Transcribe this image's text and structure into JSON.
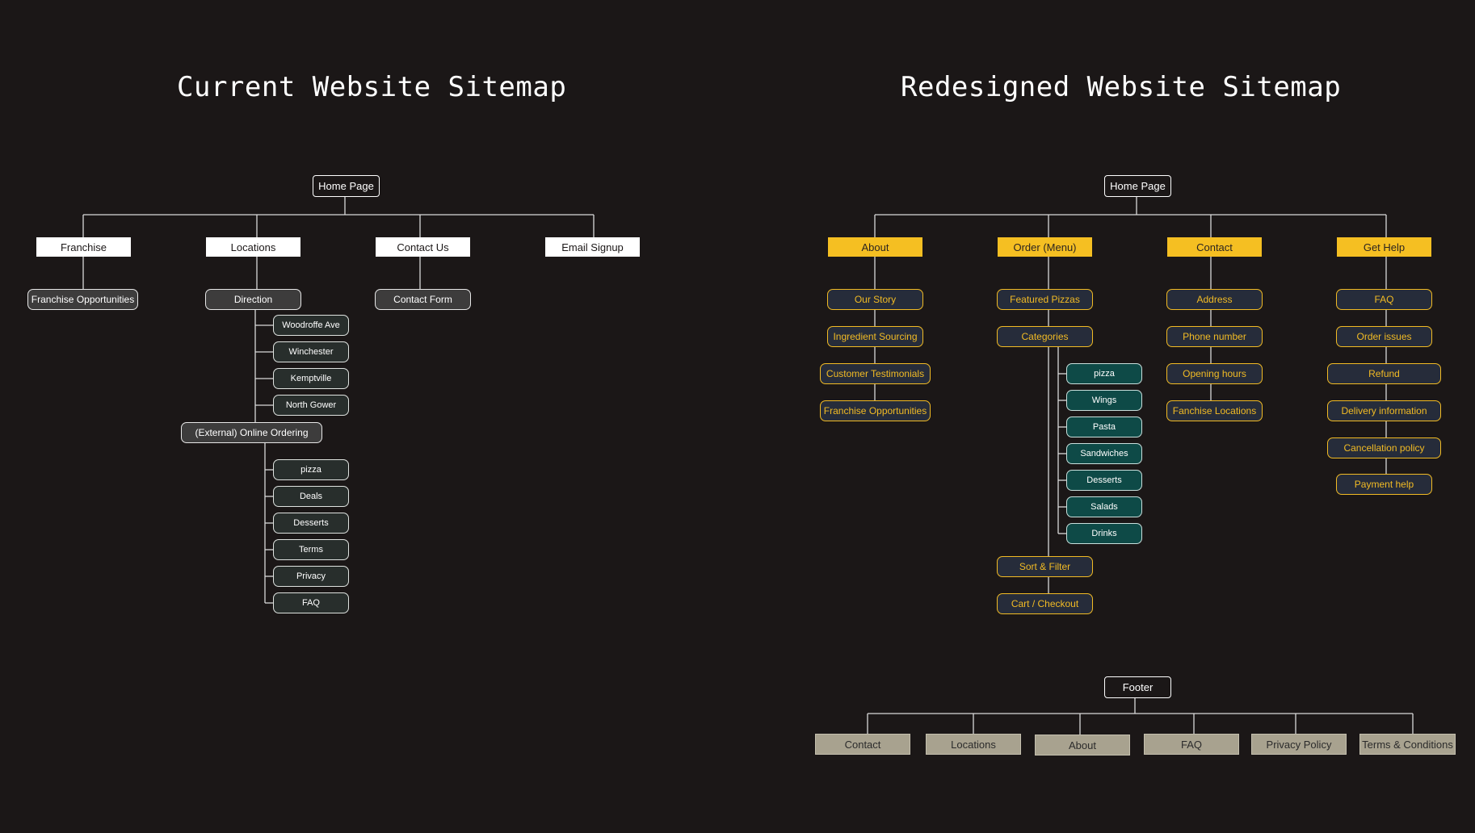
{
  "current": {
    "title": "Current Website Sitemap",
    "root": "Home Page",
    "categories": [
      "Franchise",
      "Locations",
      "Contact Us",
      "Email Signup"
    ],
    "franchise": {
      "sub": "Franchise Opportunities"
    },
    "locations": {
      "direction": "Direction",
      "direction_items": [
        "Woodroffe Ave",
        "Winchester",
        "Kemptville",
        "North Gower"
      ],
      "ordering": "(External) Online Ordering",
      "ordering_items": [
        "pizza",
        "Deals",
        "Desserts",
        "Terms",
        "Privacy",
        "FAQ"
      ]
    },
    "contact": {
      "sub": "Contact Form"
    }
  },
  "redesigned": {
    "title": "Redesigned Website Sitemap",
    "root": "Home Page",
    "categories": [
      "About",
      "Order (Menu)",
      "Contact",
      "Get Help"
    ],
    "about_items": [
      "Our Story",
      "Ingredient Sourcing",
      "Customer Testimonials",
      "Franchise Opportunities"
    ],
    "order": {
      "featured": "Featured Pizzas",
      "categories_label": "Categories",
      "category_items": [
        "pizza",
        "Wings",
        "Pasta",
        "Sandwiches",
        "Desserts",
        "Salads",
        "Drinks"
      ],
      "sort": "Sort & Filter",
      "cart": "Cart / Checkout"
    },
    "contact_items": [
      "Address",
      "Phone number",
      "Opening hours",
      "Fanchise Locations"
    ],
    "help_items": [
      "FAQ",
      "Order issues",
      "Refund",
      "Delivery information",
      "Cancellation policy",
      "Payment help"
    ],
    "footer": {
      "label": "Footer",
      "items": [
        "Contact",
        "Locations",
        "About",
        "FAQ",
        "Privacy Policy",
        "Terms & Conditions"
      ]
    }
  },
  "colors": {
    "background": "#1b1717",
    "accent_yellow": "#f5bf22",
    "navy_node": "#262c3a",
    "teal_node": "#0e4a47",
    "footer_node": "#a8a28f",
    "connector": "#d9d9d9"
  }
}
